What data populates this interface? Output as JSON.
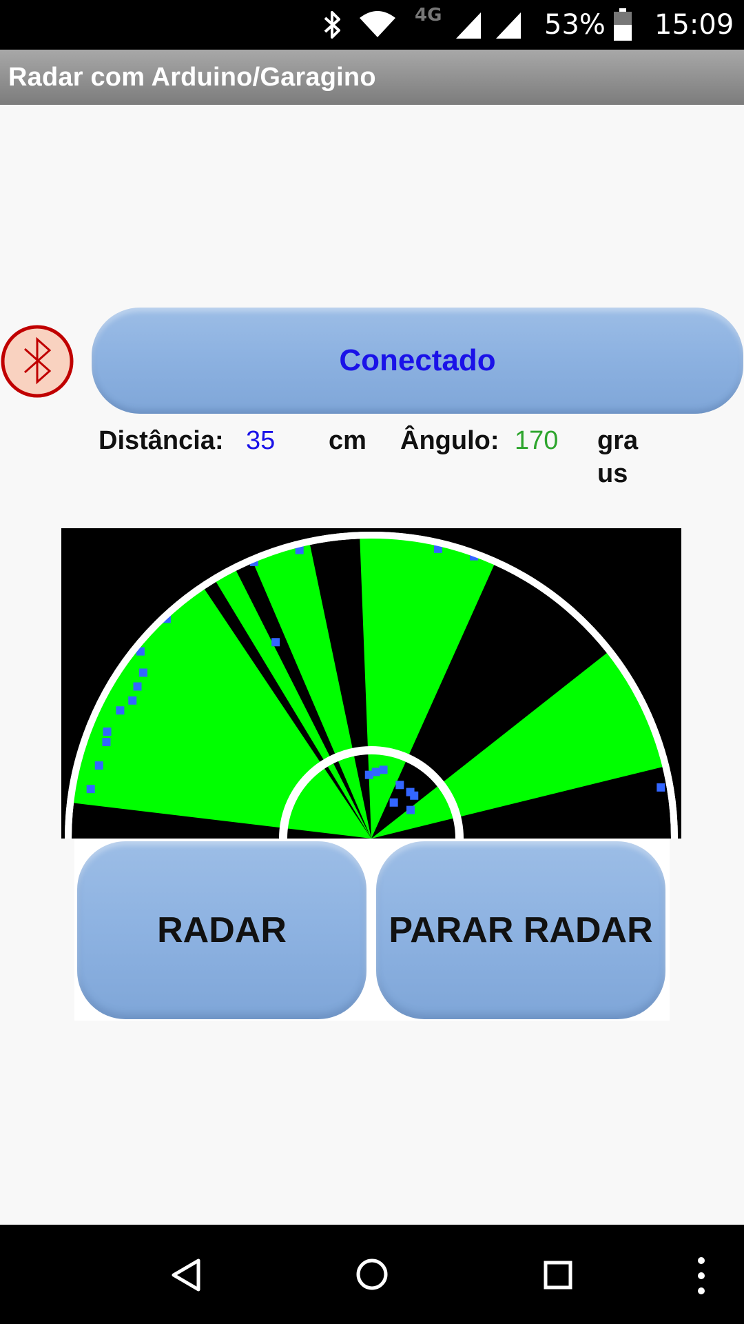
{
  "status_bar": {
    "network": "4G",
    "battery": "53%",
    "time": "15:09",
    "icons": [
      "bluetooth-icon",
      "wifi-icon",
      "signal-icon",
      "signal-icon",
      "battery-icon"
    ]
  },
  "app": {
    "title": "Radar com Arduino/Garagino"
  },
  "bluetooth": {
    "icon": "bluetooth-icon",
    "connect_label": "Conectado"
  },
  "readout": {
    "distance_label": "Distância:",
    "distance_value": "35",
    "distance_unit": "cm",
    "angle_label": "Ângulo:",
    "angle_value": "170",
    "angle_unit_line1": "gra",
    "angle_unit_line2": "us"
  },
  "colors": {
    "beam": "#00ff00",
    "blip": "#3366ff",
    "button": "#8db2e1",
    "status_blue": "#1a12e8",
    "status_green": "#2ea52e"
  },
  "radar": {
    "sweep_angles_deg": [
      171,
      169,
      167,
      165,
      163,
      160,
      158,
      155,
      153,
      151,
      148,
      146,
      144,
      142,
      140,
      138,
      136,
      134,
      131,
      128,
      126,
      119,
      111,
      108,
      106,
      104,
      90,
      88,
      87,
      85,
      83,
      80,
      78,
      76,
      74,
      70,
      68,
      36,
      34,
      32,
      30,
      28,
      26,
      22,
      20,
      18,
      16
    ],
    "blips": [
      [
        170,
        0.94
      ],
      [
        165,
        0.93
      ],
      [
        160,
        0.93
      ],
      [
        158,
        0.94
      ],
      [
        153,
        0.93
      ],
      [
        150,
        0.91
      ],
      [
        147,
        0.92
      ],
      [
        144,
        0.93
      ],
      [
        141,
        0.98
      ],
      [
        133,
        0.99
      ],
      [
        116,
        0.72
      ],
      [
        113,
        0.99
      ],
      [
        104,
        0.98
      ],
      [
        77,
        0.98
      ],
      [
        70,
        0.99
      ],
      [
        10,
        0.97
      ],
      [
        92,
        0.21
      ],
      [
        86,
        0.22
      ],
      [
        80,
        0.23
      ],
      [
        62,
        0.2
      ],
      [
        50,
        0.2
      ],
      [
        45,
        0.2
      ],
      [
        36,
        0.16
      ],
      [
        58,
        0.14
      ]
    ]
  },
  "buttons": {
    "radar": "RADAR",
    "stop_radar": "PARAR RADAR"
  },
  "nav": {
    "back": "back-icon",
    "home": "home-icon",
    "recents": "recents-icon",
    "menu": "overflow-menu-icon"
  }
}
